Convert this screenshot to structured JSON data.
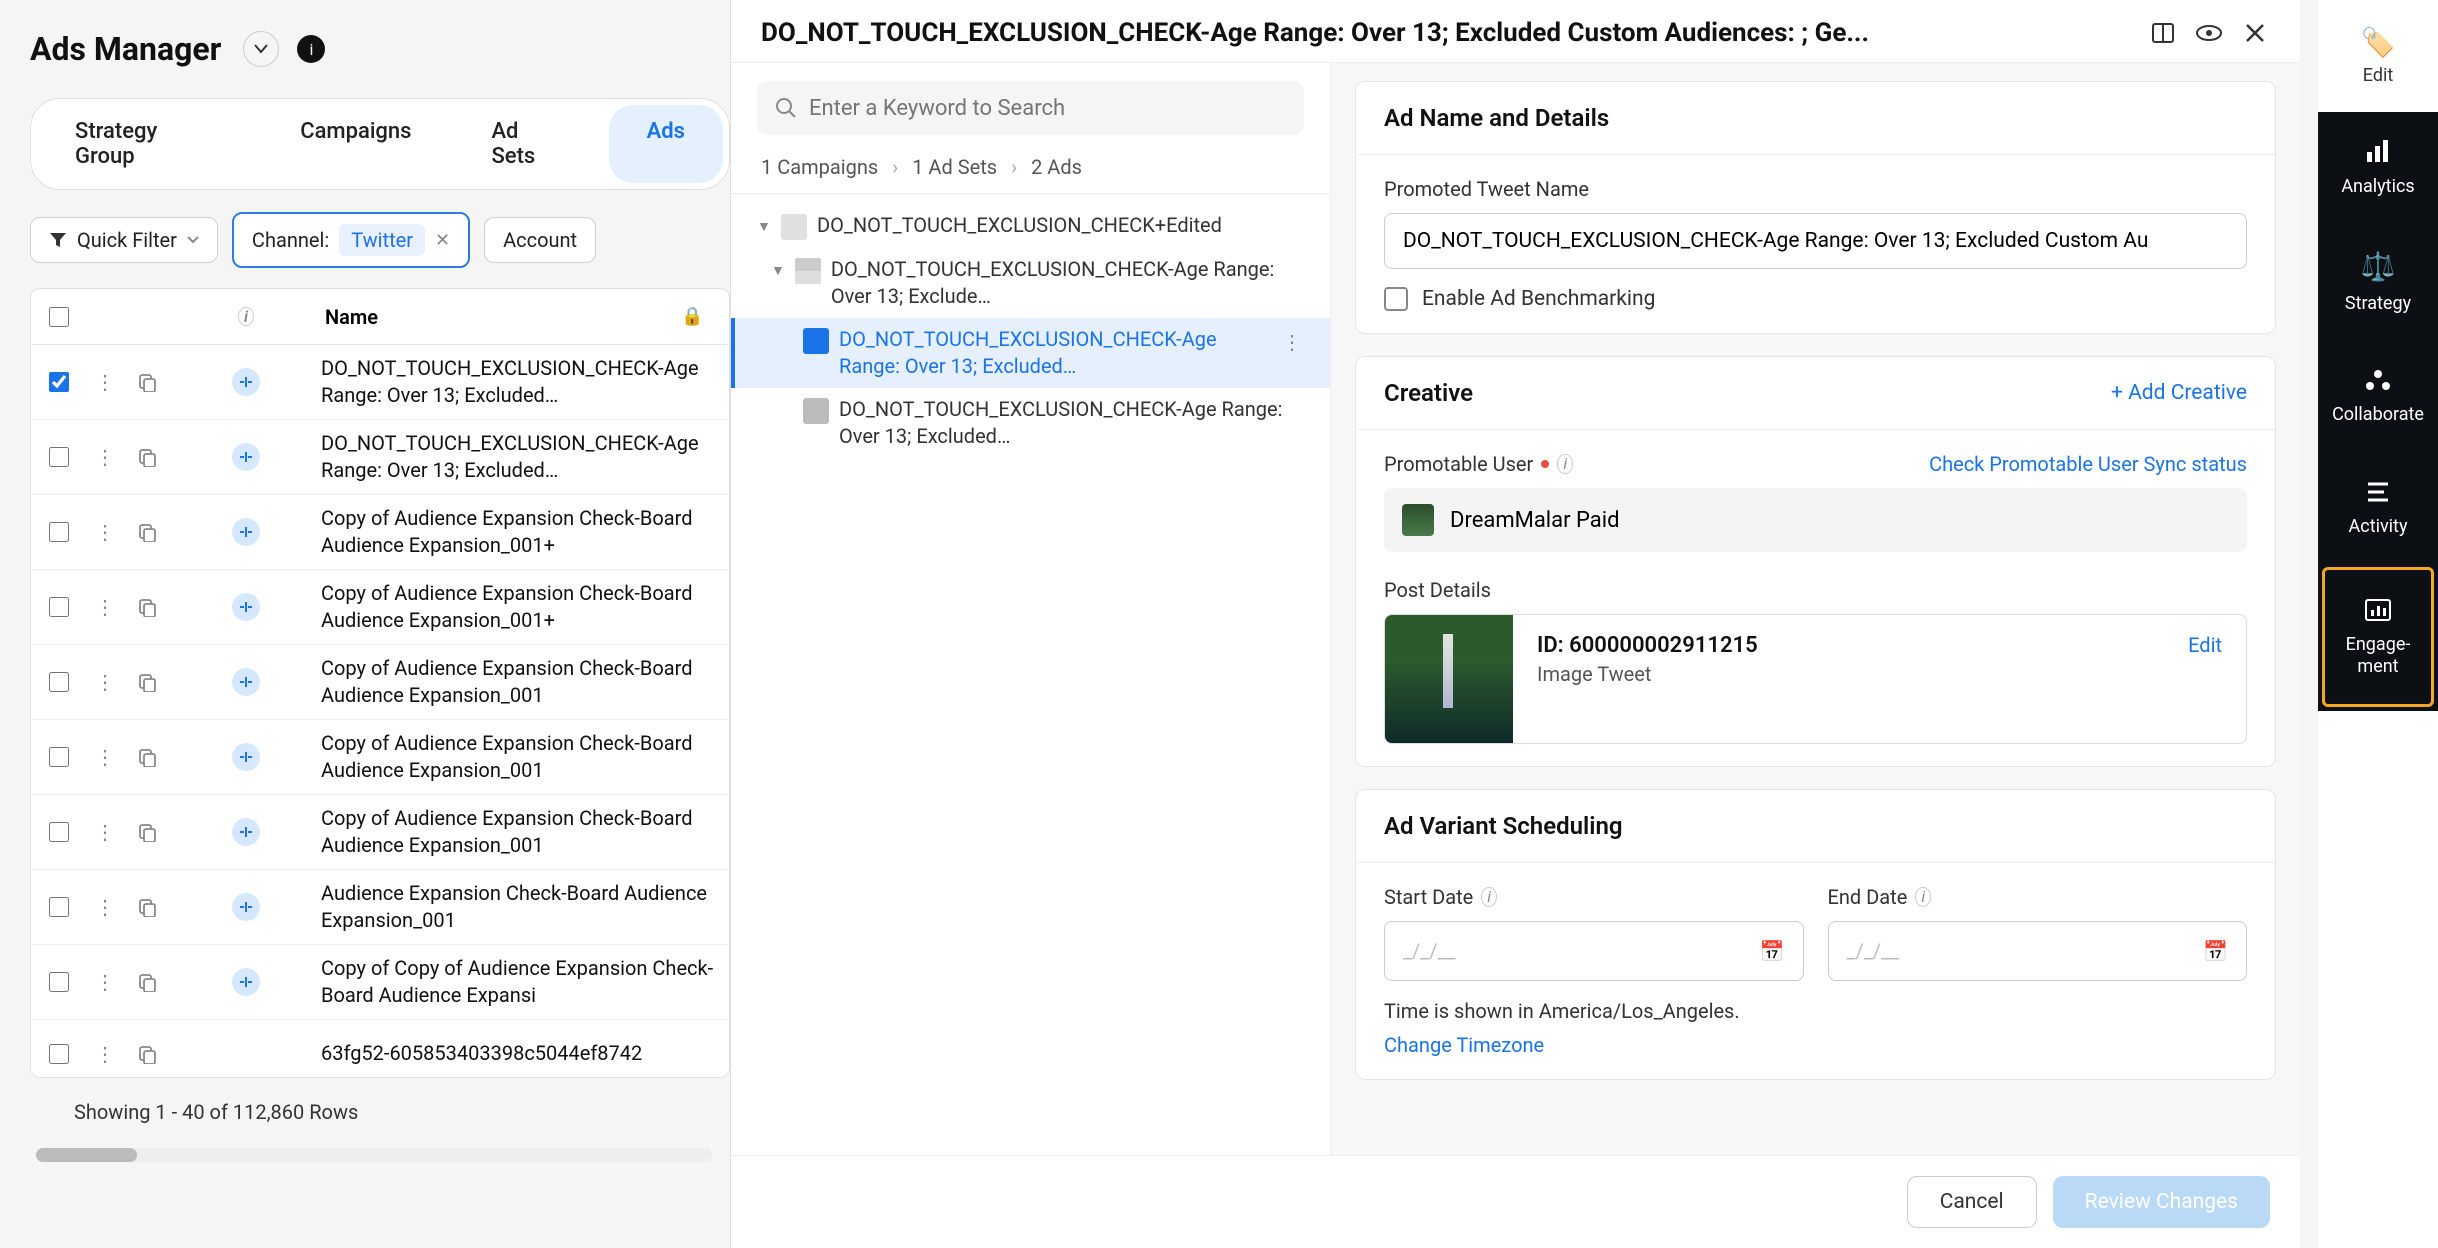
{
  "header": {
    "title": "Ads Manager"
  },
  "tabs": {
    "strategy": "Strategy Group",
    "campaigns": "Campaigns",
    "adsets": "Ad Sets",
    "ads": "Ads"
  },
  "filters": {
    "quick_filter": "Quick Filter",
    "channel_label": "Channel:",
    "channel_value": "Twitter",
    "account": "Account"
  },
  "table": {
    "header_name": "Name",
    "rows": [
      {
        "name": "DO_NOT_TOUCH_EXCLUSION_CHECK-Age Range: Over 13; Excluded…",
        "status": true,
        "checked": true
      },
      {
        "name": "DO_NOT_TOUCH_EXCLUSION_CHECK-Age Range: Over 13; Excluded…",
        "status": true,
        "checked": false
      },
      {
        "name": "Copy of Audience Expansion Check-Board Audience Expansion_001+",
        "status": true,
        "checked": false
      },
      {
        "name": "Copy of Audience Expansion Check-Board Audience Expansion_001+",
        "status": true,
        "checked": false
      },
      {
        "name": "Copy of Audience Expansion Check-Board Audience Expansion_001",
        "status": true,
        "checked": false
      },
      {
        "name": "Copy of Audience Expansion Check-Board Audience Expansion_001",
        "status": true,
        "checked": false
      },
      {
        "name": "Copy of Audience Expansion Check-Board Audience Expansion_001",
        "status": true,
        "checked": false
      },
      {
        "name": "Audience Expansion Check-Board Audience Expansion_001",
        "status": true,
        "checked": false
      },
      {
        "name": "Copy of Copy of Audience Expansion Check-Board Audience Expansi",
        "status": true,
        "checked": false
      },
      {
        "name": "63fg52-605853403398c5044ef8742",
        "status": false,
        "checked": false
      }
    ],
    "footer": "Showing 1 - 40 of 112,860 Rows"
  },
  "editor": {
    "title": "DO_NOT_TOUCH_EXCLUSION_CHECK-Age Range: Over 13; Excluded Custom Audiences: ; Ge...",
    "search_placeholder": "Enter a Keyword to Search",
    "breadcrumbs": {
      "campaigns": "1 Campaigns",
      "adsets": "1 Ad Sets",
      "ads": "2 Ads"
    },
    "tree": {
      "l1": "DO_NOT_TOUCH_EXCLUSION_CHECK+Edited",
      "l2": "DO_NOT_TOUCH_EXCLUSION_CHECK-Age Range: Over 13; Exclude…",
      "l3a": "DO_NOT_TOUCH_EXCLUSION_CHECK-Age Range: Over 13; Excluded…",
      "l3b": "DO_NOT_TOUCH_EXCLUSION_CHECK-Age Range: Over 13; Excluded…"
    },
    "detail": {
      "section_name": "Ad Name and Details",
      "promoted_label": "Promoted Tweet Name",
      "promoted_value": "DO_NOT_TOUCH_EXCLUSION_CHECK-Age Range: Over 13; Excluded Custom Au",
      "benchmark": "Enable Ad Benchmarking",
      "creative_title": "Creative",
      "add_creative": "+ Add Creative",
      "promotable_user_label": "Promotable User",
      "check_sync": "Check Promotable User Sync status",
      "user_name": "DreamMalar Paid",
      "post_details_label": "Post Details",
      "post_id": "ID: 600000002911215",
      "post_type": "Image Tweet",
      "edit": "Edit",
      "scheduling_title": "Ad Variant Scheduling",
      "start_date": "Start Date",
      "end_date": "End Date",
      "date_placeholder": "_/_/__",
      "tz_text": "Time is shown in America/Los_Angeles.",
      "tz_link": "Change Timezone"
    },
    "footer": {
      "cancel": "Cancel",
      "review": "Review Changes"
    }
  },
  "rail": {
    "edit": "Edit",
    "analytics": "Analytics",
    "strategy": "Strategy",
    "collaborate": "Collaborate",
    "activity": "Activity",
    "engagement": "Engage-\nment"
  }
}
